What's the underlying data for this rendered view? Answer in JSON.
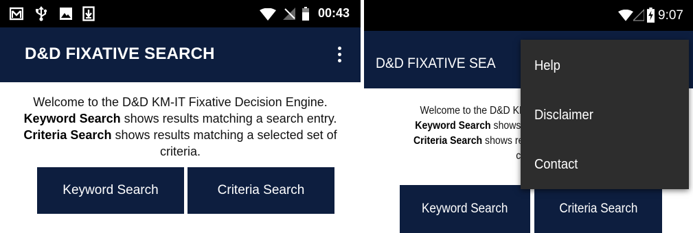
{
  "colors": {
    "status_bar": "#000000",
    "app_bar": "#0d1e3f",
    "button": "#0d1e3f",
    "menu_background": "#2d2d2d",
    "text_on_dark": "#ffffff",
    "body_text": "#111111"
  },
  "left_screen": {
    "status_bar": {
      "time": "00:43",
      "left_icons": [
        "gmail-icon",
        "usb-debug-icon",
        "gallery-icon",
        "download-icon"
      ],
      "right_icons": [
        "wifi-icon",
        "no-signal-icon",
        "battery-icon"
      ]
    },
    "app_bar": {
      "title": "D&D FIXATIVE SEARCH",
      "overflow_icon": "more-vertical-icon"
    },
    "welcome": {
      "line1": "Welcome to the D&D KM-IT Fixative Decision Engine.",
      "keyword_label": "Keyword Search",
      "keyword_desc": " shows results matching a search entry. ",
      "criteria_label": "Criteria Search",
      "criteria_desc": " shows results matching a selected set of criteria."
    },
    "buttons": {
      "keyword": "Keyword Search",
      "criteria": "Criteria Search"
    }
  },
  "right_screen": {
    "status_bar": {
      "time": "9:07",
      "right_icons": [
        "wifi-icon",
        "no-signal-icon",
        "battery-charging-icon"
      ]
    },
    "app_bar": {
      "title": "D&D FIXATIVE SEA"
    },
    "welcome": {
      "line1": "Welcome to the D&D KM",
      "line2_bold": "Keyword Search",
      "line2_rest": " shows re",
      "line3_bold": "Criteria Search",
      "line3_rest": " shows resu",
      "line4": "cr"
    },
    "buttons": {
      "keyword": "Keyword Search",
      "criteria": "Criteria Search"
    },
    "overflow_menu": {
      "items": [
        "Help",
        "Disclaimer",
        "Contact"
      ]
    }
  }
}
